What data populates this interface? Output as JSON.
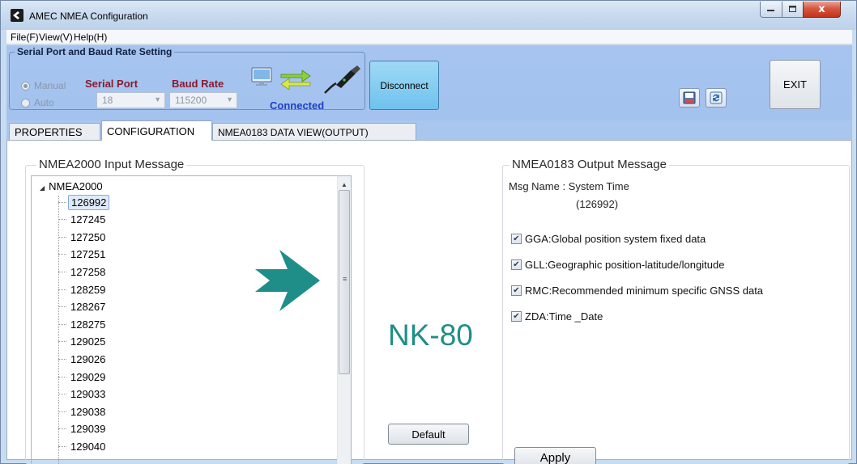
{
  "window": {
    "title": "AMEC NMEA Configuration",
    "close_glyph": "x"
  },
  "menu": {
    "file": "File(F)",
    "view": "View(V)",
    "help": "Help(H)"
  },
  "serial": {
    "group_title": "Serial Port and Baud Rate Setting",
    "radio_manual": "Manual",
    "radio_auto": "Auto",
    "serial_port_label": "Serial Port",
    "baud_rate_label": "Baud Rate",
    "serial_port_value": "18",
    "baud_rate_value": "115200",
    "status": "Connected"
  },
  "toolbar": {
    "disconnect_label": "Disconnect",
    "exit_label": "EXIT"
  },
  "tabs": [
    {
      "label": "PROPERTIES"
    },
    {
      "label": "CONFIGURATION"
    },
    {
      "label": "NMEA0183 DATA VIEW(OUTPUT)"
    }
  ],
  "input": {
    "group_title": "NMEA2000 Input Message",
    "root": "NMEA2000",
    "items": [
      "126992",
      "127245",
      "127250",
      "127251",
      "127258",
      "128259",
      "128267",
      "128275",
      "129025",
      "129026",
      "129029",
      "129033",
      "129038",
      "129039",
      "129040"
    ],
    "selected_index": 0
  },
  "center": {
    "device_label": "NK-80",
    "default_label": "Default",
    "arrow_color": "#1f8e88"
  },
  "output": {
    "group_title": "NMEA0183 Output Message",
    "msg_name": "Msg Name : System Time",
    "msg_id": "(126992)",
    "sentences": [
      {
        "label": "GGA:Global position system fixed data",
        "checked": true
      },
      {
        "label": "GLL:Geographic position-latitude/longitude",
        "checked": true
      },
      {
        "label": "RMC:Recommended minimum specific GNSS data",
        "checked": true
      },
      {
        "label": "ZDA:Time _Date",
        "checked": true
      }
    ],
    "apply_label": "Apply"
  }
}
